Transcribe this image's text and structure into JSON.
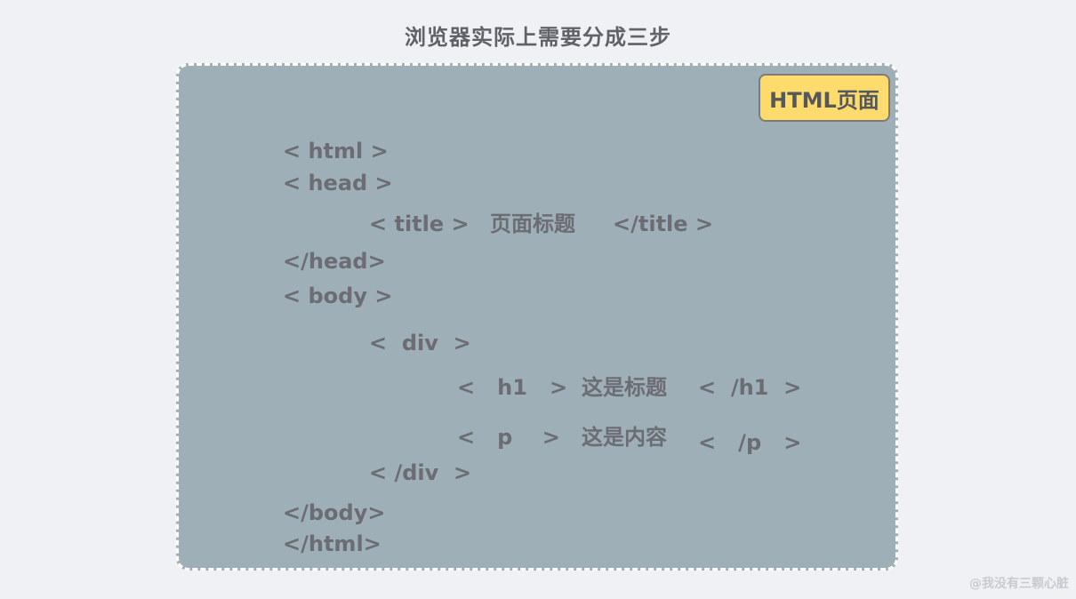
{
  "title": "浏览器实际上需要分成三步",
  "badge": "HTML页面",
  "lines": {
    "html_open": "< html >",
    "head_open": "< head >",
    "title_open": "< title >",
    "title_text": "页面标题",
    "title_close": "</title >",
    "head_close": "</head>",
    "body_open": "< body >",
    "div_open": "<  div  >",
    "h1_open": "<   h1   >",
    "h1_text": "这是标题",
    "h1_close": "<  /h1  >",
    "p_open": "<   p    >",
    "p_text": "这是内容",
    "p_close": "<   /p   >",
    "div_close": "< /div  >",
    "body_close": "</body>",
    "html_close": "</html>"
  },
  "watermark": "@我没有三颗心脏"
}
